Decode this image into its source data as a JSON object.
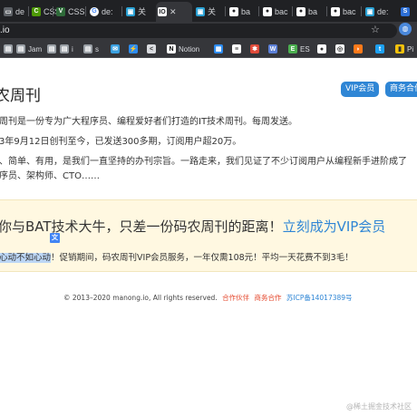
{
  "tabs": [
    {
      "label": "de",
      "icon": "doc-icon",
      "color": "#4d90fe"
    },
    {
      "label": "CSS",
      "icon": "css-icon",
      "color": "#4e9a06"
    },
    {
      "label": "CSS",
      "icon": "v-icon",
      "color": "#3ab36b"
    },
    {
      "label": "de:",
      "icon": "google-icon",
      "color": "#4285f4"
    },
    {
      "label": "关 ",
      "icon": "page-icon",
      "color": "#2aa1d4"
    },
    {
      "label": "IO",
      "icon": "io-icon",
      "color": "#ffffff",
      "active": true
    },
    {
      "label": "关 ",
      "icon": "page-icon",
      "color": "#2aa1d4"
    },
    {
      "label": "ba",
      "icon": "bear-icon",
      "color": "#ffffff"
    },
    {
      "label": "bac",
      "icon": "bear-icon",
      "color": "#ffffff"
    },
    {
      "label": "ba",
      "icon": "bear-icon",
      "color": "#ffffff"
    },
    {
      "label": "bac",
      "icon": "bear-icon",
      "color": "#ffffff"
    },
    {
      "label": "de:",
      "icon": "page-icon",
      "color": "#2aa1d4"
    }
  ],
  "url": ".io",
  "bookmarks": [
    {
      "label": "Jam",
      "icon": "folder-icon"
    },
    {
      "label": "i",
      "icon": "folder-icon"
    },
    {
      "label": "s",
      "icon": "folder-icon"
    },
    {
      "label": "Notion",
      "icon": "notion-icon"
    },
    {
      "label": "ES",
      "icon": "es-icon"
    },
    {
      "label": "Pi",
      "icon": "pi-icon"
    }
  ],
  "page": {
    "title": "农周刊",
    "vip_button": "VIP会员",
    "business_button": "商务合作",
    "paragraphs": [
      "周刊是一份专为广大程序员、编程爱好者们打造的IT技术周刊。每周发送。",
      "3年9月12日创刊至今，已发送300多期，订阅用户超20万。",
      "、简单、有用，是我们一直坚持的办刊宗旨。一路走来，我们见证了不少订阅用户从编程新手进阶成了",
      "序员、架构师、CTO……"
    ],
    "vip_headline": "你与BAT技术大牛，只差一份码农周刊的距离！",
    "vip_link": "立刻成为VIP会员",
    "vip_sub_selected": "心动不如心动",
    "vip_sub_rest": "！促销期间，码农周刊VIP会员服务，一年仅需108元！平均一天花费不到3毛！",
    "footer_copyright": "© 2013–2020 manong.io, All rights reserved.",
    "footer_link1": "合作伙伴",
    "footer_link2": "商务合作",
    "footer_link3": "苏ICP备14017389号"
  },
  "watermark": "@稀土掘金技术社区"
}
